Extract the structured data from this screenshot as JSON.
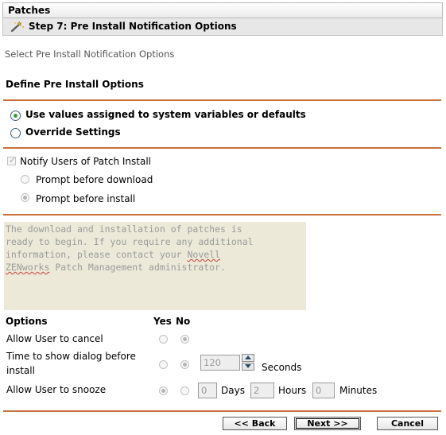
{
  "window": {
    "title": "Patches"
  },
  "step": {
    "title": "Step 7: Pre Install Notification Options",
    "icon": "wand-icon"
  },
  "subtitle": "Select Pre Install Notification Options",
  "section_heading": "Define Pre Install Options",
  "mode": {
    "use_defaults_label": "Use values assigned to system variables or defaults",
    "override_label": "Override Settings",
    "selected": "use_defaults"
  },
  "notify": {
    "checkbox_label": "Notify Users of Patch Install",
    "checked": true,
    "prompt_download_label": "Prompt before download",
    "prompt_install_label": "Prompt before install",
    "selected": "prompt_install"
  },
  "message": {
    "line1": "The download and installation of patches is",
    "line2": "ready to begin. If you require any additional",
    "line3a": "information, please contact your ",
    "line3b": "Novell",
    "line4a": "ZENworks",
    "line4b": " Patch Management administrator."
  },
  "options": {
    "header": "Options",
    "yes": "Yes",
    "no": "No",
    "allow_cancel": {
      "label": "Allow User to cancel",
      "selected": "no"
    },
    "show_dialog": {
      "label_line1": "Time to show dialog before",
      "label_line2": "install",
      "selected": "no",
      "value": "120",
      "unit": "Seconds"
    },
    "snooze": {
      "label": "Allow User to snooze",
      "selected": "yes",
      "days": "0",
      "days_label": "Days",
      "hours": "2",
      "hours_label": "Hours",
      "minutes": "0",
      "minutes_label": "Minutes"
    }
  },
  "buttons": {
    "back": "<< Back",
    "next": "Next >>",
    "cancel": "Cancel"
  }
}
